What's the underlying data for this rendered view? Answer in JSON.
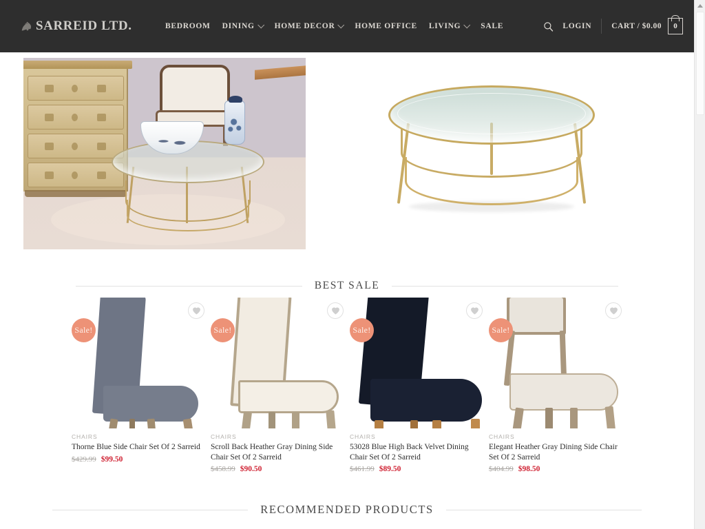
{
  "header": {
    "logo_text": "SARREID LTD.",
    "logo_icon": "horse-emblem-icon",
    "nav": [
      {
        "label": "BEDROOM",
        "has_dropdown": false
      },
      {
        "label": "DINING",
        "has_dropdown": true
      },
      {
        "label": "HOME DECOR",
        "has_dropdown": true
      },
      {
        "label": "HOME OFFICE",
        "has_dropdown": false
      },
      {
        "label": "LIVING",
        "has_dropdown": true
      },
      {
        "label": "SALE",
        "has_dropdown": false
      }
    ],
    "search_icon": "search-icon",
    "login_label": "LOGIN",
    "cart_label": "CART / $0.00",
    "cart_count": "0",
    "background_color": "#2e2e2e",
    "text_color": "#ddd9d3"
  },
  "hero": {
    "left_image_alt": "Room setting with wood dresser, upholstered armchair, blue-and-white bowl and ginger jar on a round glass-top brass coffee table",
    "right_image_alt": "Round glass-top brass coffee table on white background"
  },
  "sections": {
    "best_sale_title": "BEST SALE",
    "recommended_title": "RECOMMENDED PRODUCTS"
  },
  "products": [
    {
      "category": "CHAIRS",
      "title": "Thorne Blue Side Chair Set Of 2 Sarreid",
      "price_old": "$429.99",
      "price_new": "$99.50",
      "badge": "Sale!",
      "wishlist_icon": "heart-icon",
      "upholstery_color": "#6e7585",
      "leg_color": "#a08c6f"
    },
    {
      "category": "CHAIRS",
      "title": "Scroll Back Heather Gray Dining Side Chair Set Of 2 Sarreid",
      "price_old": "$458.99",
      "price_new": "$90.50",
      "badge": "Sale!",
      "wishlist_icon": "heart-icon",
      "upholstery_color": "#f2ece2",
      "leg_color": "#b0a187"
    },
    {
      "category": "CHAIRS",
      "title": "53028 Blue High Back Velvet Dining Chair Set Of 2 Sarreid",
      "price_old": "$461.99",
      "price_new": "$89.50",
      "badge": "Sale!",
      "wishlist_icon": "heart-icon",
      "upholstery_color": "#141a28",
      "leg_color": "#b57f43"
    },
    {
      "category": "CHAIRS",
      "title": "Elegant Heather Gray Dining Side Chair Set Of 2 Sarreid",
      "price_old": "$404.99",
      "price_new": "$98.50",
      "badge": "Sale!",
      "wishlist_icon": "heart-icon",
      "upholstery_color": "#e9e4dc",
      "leg_color": "#a59madd"
    }
  ],
  "colors": {
    "sale_badge": "#ed9277",
    "sale_price": "#cf2031",
    "old_price": "#a8a5a1",
    "category_label": "#b3b0ac",
    "heading": "#4a4a4a"
  },
  "scrollbar": {
    "up_arrow_icon": "scroll-up-arrow-icon"
  }
}
